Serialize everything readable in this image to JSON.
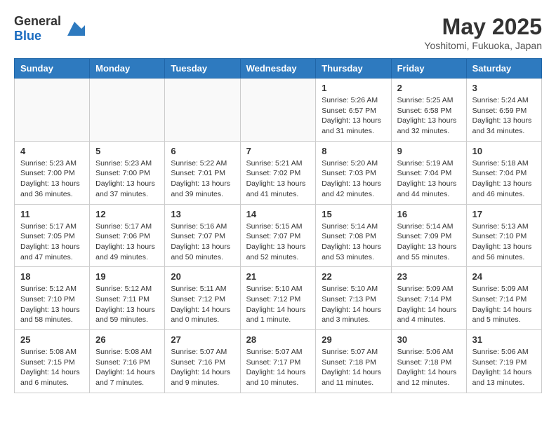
{
  "header": {
    "logo_general": "General",
    "logo_blue": "Blue",
    "month_title": "May 2025",
    "location": "Yoshitomi, Fukuoka, Japan"
  },
  "days_of_week": [
    "Sunday",
    "Monday",
    "Tuesday",
    "Wednesday",
    "Thursday",
    "Friday",
    "Saturday"
  ],
  "weeks": [
    [
      {
        "day": "",
        "info": ""
      },
      {
        "day": "",
        "info": ""
      },
      {
        "day": "",
        "info": ""
      },
      {
        "day": "",
        "info": ""
      },
      {
        "day": "1",
        "info": "Sunrise: 5:26 AM\nSunset: 6:57 PM\nDaylight: 13 hours and 31 minutes."
      },
      {
        "day": "2",
        "info": "Sunrise: 5:25 AM\nSunset: 6:58 PM\nDaylight: 13 hours and 32 minutes."
      },
      {
        "day": "3",
        "info": "Sunrise: 5:24 AM\nSunset: 6:59 PM\nDaylight: 13 hours and 34 minutes."
      }
    ],
    [
      {
        "day": "4",
        "info": "Sunrise: 5:23 AM\nSunset: 7:00 PM\nDaylight: 13 hours and 36 minutes."
      },
      {
        "day": "5",
        "info": "Sunrise: 5:23 AM\nSunset: 7:00 PM\nDaylight: 13 hours and 37 minutes."
      },
      {
        "day": "6",
        "info": "Sunrise: 5:22 AM\nSunset: 7:01 PM\nDaylight: 13 hours and 39 minutes."
      },
      {
        "day": "7",
        "info": "Sunrise: 5:21 AM\nSunset: 7:02 PM\nDaylight: 13 hours and 41 minutes."
      },
      {
        "day": "8",
        "info": "Sunrise: 5:20 AM\nSunset: 7:03 PM\nDaylight: 13 hours and 42 minutes."
      },
      {
        "day": "9",
        "info": "Sunrise: 5:19 AM\nSunset: 7:04 PM\nDaylight: 13 hours and 44 minutes."
      },
      {
        "day": "10",
        "info": "Sunrise: 5:18 AM\nSunset: 7:04 PM\nDaylight: 13 hours and 46 minutes."
      }
    ],
    [
      {
        "day": "11",
        "info": "Sunrise: 5:17 AM\nSunset: 7:05 PM\nDaylight: 13 hours and 47 minutes."
      },
      {
        "day": "12",
        "info": "Sunrise: 5:17 AM\nSunset: 7:06 PM\nDaylight: 13 hours and 49 minutes."
      },
      {
        "day": "13",
        "info": "Sunrise: 5:16 AM\nSunset: 7:07 PM\nDaylight: 13 hours and 50 minutes."
      },
      {
        "day": "14",
        "info": "Sunrise: 5:15 AM\nSunset: 7:07 PM\nDaylight: 13 hours and 52 minutes."
      },
      {
        "day": "15",
        "info": "Sunrise: 5:14 AM\nSunset: 7:08 PM\nDaylight: 13 hours and 53 minutes."
      },
      {
        "day": "16",
        "info": "Sunrise: 5:14 AM\nSunset: 7:09 PM\nDaylight: 13 hours and 55 minutes."
      },
      {
        "day": "17",
        "info": "Sunrise: 5:13 AM\nSunset: 7:10 PM\nDaylight: 13 hours and 56 minutes."
      }
    ],
    [
      {
        "day": "18",
        "info": "Sunrise: 5:12 AM\nSunset: 7:10 PM\nDaylight: 13 hours and 58 minutes."
      },
      {
        "day": "19",
        "info": "Sunrise: 5:12 AM\nSunset: 7:11 PM\nDaylight: 13 hours and 59 minutes."
      },
      {
        "day": "20",
        "info": "Sunrise: 5:11 AM\nSunset: 7:12 PM\nDaylight: 14 hours and 0 minutes."
      },
      {
        "day": "21",
        "info": "Sunrise: 5:10 AM\nSunset: 7:12 PM\nDaylight: 14 hours and 1 minute."
      },
      {
        "day": "22",
        "info": "Sunrise: 5:10 AM\nSunset: 7:13 PM\nDaylight: 14 hours and 3 minutes."
      },
      {
        "day": "23",
        "info": "Sunrise: 5:09 AM\nSunset: 7:14 PM\nDaylight: 14 hours and 4 minutes."
      },
      {
        "day": "24",
        "info": "Sunrise: 5:09 AM\nSunset: 7:14 PM\nDaylight: 14 hours and 5 minutes."
      }
    ],
    [
      {
        "day": "25",
        "info": "Sunrise: 5:08 AM\nSunset: 7:15 PM\nDaylight: 14 hours and 6 minutes."
      },
      {
        "day": "26",
        "info": "Sunrise: 5:08 AM\nSunset: 7:16 PM\nDaylight: 14 hours and 7 minutes."
      },
      {
        "day": "27",
        "info": "Sunrise: 5:07 AM\nSunset: 7:16 PM\nDaylight: 14 hours and 9 minutes."
      },
      {
        "day": "28",
        "info": "Sunrise: 5:07 AM\nSunset: 7:17 PM\nDaylight: 14 hours and 10 minutes."
      },
      {
        "day": "29",
        "info": "Sunrise: 5:07 AM\nSunset: 7:18 PM\nDaylight: 14 hours and 11 minutes."
      },
      {
        "day": "30",
        "info": "Sunrise: 5:06 AM\nSunset: 7:18 PM\nDaylight: 14 hours and 12 minutes."
      },
      {
        "day": "31",
        "info": "Sunrise: 5:06 AM\nSunset: 7:19 PM\nDaylight: 14 hours and 13 minutes."
      }
    ]
  ]
}
